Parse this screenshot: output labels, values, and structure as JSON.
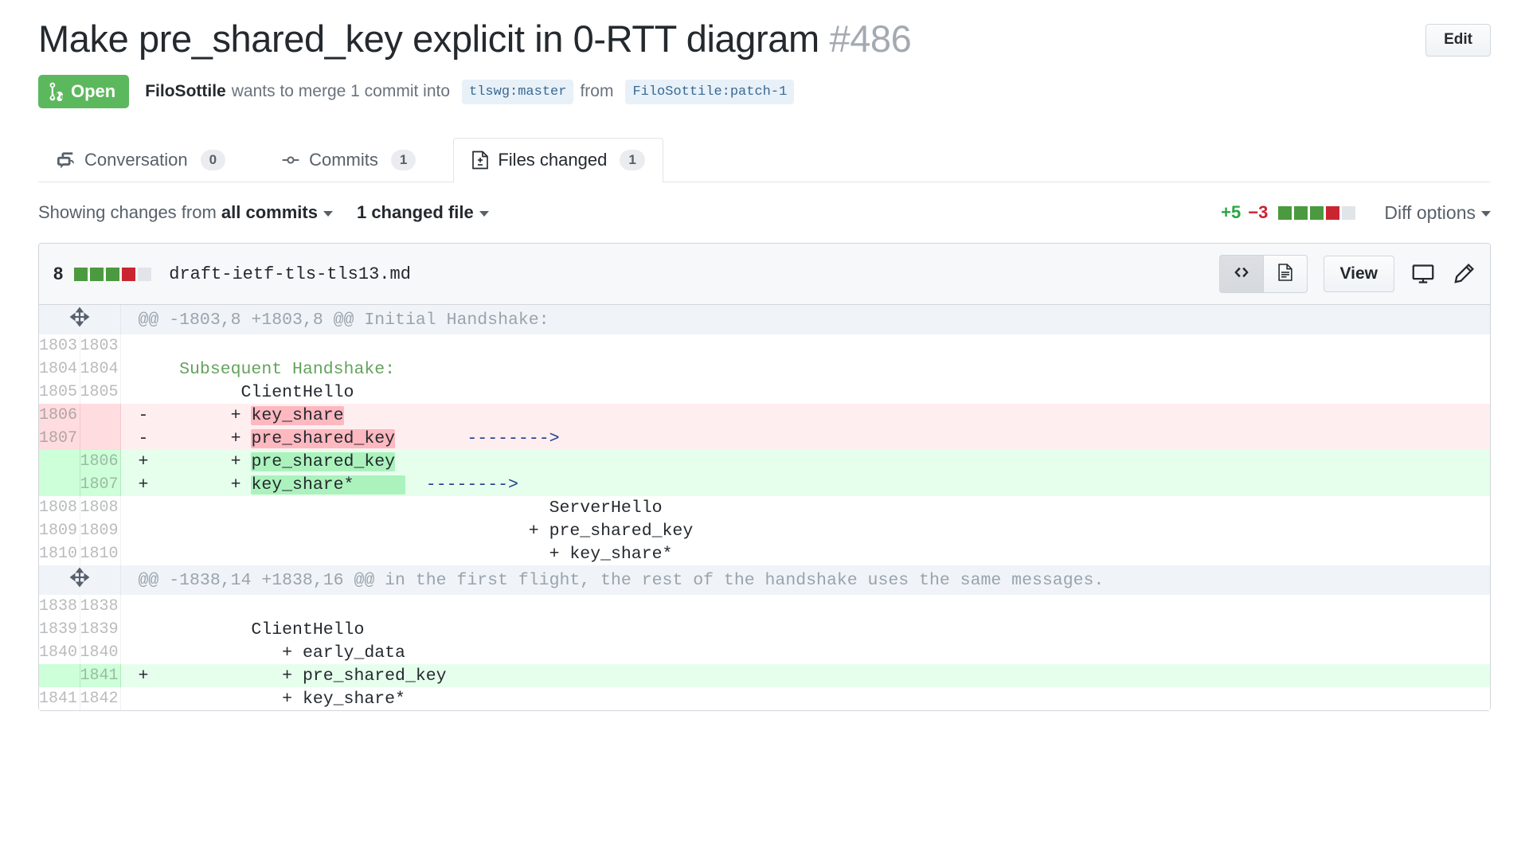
{
  "header": {
    "title": "Make pre_shared_key explicit in 0-RTT diagram",
    "number": "#486",
    "edit_label": "Edit",
    "state": "Open",
    "author": "FiloSottile",
    "merge_text_1": "wants to merge 1 commit into",
    "base_branch": "tlswg:master",
    "from_word": "from",
    "head_branch": "FiloSottile:patch-1"
  },
  "tabs": [
    {
      "label": "Conversation",
      "count": "0",
      "icon": "comment-discussion-icon",
      "active": false
    },
    {
      "label": "Commits",
      "count": "1",
      "icon": "git-commit-icon",
      "active": false
    },
    {
      "label": "Files changed",
      "count": "1",
      "icon": "diff-file-icon",
      "active": true
    }
  ],
  "toolbar": {
    "showing_prefix": "Showing changes from",
    "commits_filter": "all commits",
    "files_filter": "1 changed file",
    "additions": "+5",
    "deletions": "−3",
    "blocks": [
      "a",
      "a",
      "a",
      "d",
      "n"
    ],
    "diff_options": "Diff options"
  },
  "file": {
    "changes_count": "8",
    "blocks": [
      "a",
      "a",
      "a",
      "d",
      "n"
    ],
    "name": "draft-ietf-tls-tls13.md",
    "view_label": "View",
    "code_toggle_icon": "code-icon",
    "rendered_toggle_icon": "document-icon",
    "display_icon": "desktop-icon",
    "edit_icon": "pencil-icon"
  },
  "colors": {
    "open_green": "#5cb85c",
    "add_green": "#28a745",
    "del_red": "#cb2431",
    "word_add": "#acf2bd",
    "word_del": "#fdb8c0",
    "row_add": "#e6ffed",
    "row_del": "#ffeef0",
    "arrow_blue": "#1f3f8f"
  },
  "diff": {
    "hunks": [
      {
        "header": "@@ -1803,8 +1803,8 @@ Initial Handshake:",
        "rows": [
          {
            "type": "ctx",
            "old": "1803",
            "new": "1803",
            "marker": "",
            "segments": []
          },
          {
            "type": "ctx",
            "old": "1804",
            "new": "1804",
            "marker": "",
            "segments": [
              {
                "text": "   Subsequent Handshake:",
                "style": "md-h"
              }
            ]
          },
          {
            "type": "ctx",
            "old": "1805",
            "new": "1805",
            "marker": "",
            "segments": [
              {
                "text": "         ClientHello",
                "style": ""
              }
            ]
          },
          {
            "type": "del",
            "old": "1806",
            "new": "",
            "marker": "-",
            "segments": [
              {
                "text": "        + ",
                "style": ""
              },
              {
                "text": "key_share",
                "style": "wd-del"
              }
            ]
          },
          {
            "type": "del",
            "old": "1807",
            "new": "",
            "marker": "-",
            "segments": [
              {
                "text": "        + ",
                "style": ""
              },
              {
                "text": "pre_shared_key",
                "style": "wd-del"
              },
              {
                "text": "       ",
                "style": ""
              },
              {
                "text": "-------->",
                "style": "arrow"
              }
            ]
          },
          {
            "type": "add",
            "old": "",
            "new": "1806",
            "marker": "+",
            "segments": [
              {
                "text": "        + ",
                "style": ""
              },
              {
                "text": "pre_shared_key",
                "style": "wd-add"
              }
            ]
          },
          {
            "type": "add",
            "old": "",
            "new": "1807",
            "marker": "+",
            "segments": [
              {
                "text": "        + ",
                "style": ""
              },
              {
                "text": "key_share*     ",
                "style": "wd-add"
              },
              {
                "text": "  ",
                "style": ""
              },
              {
                "text": "-------->",
                "style": "arrow"
              }
            ]
          },
          {
            "type": "ctx",
            "old": "1808",
            "new": "1808",
            "marker": "",
            "segments": [
              {
                "text": "                                       ServerHello",
                "style": ""
              }
            ]
          },
          {
            "type": "ctx",
            "old": "1809",
            "new": "1809",
            "marker": "",
            "segments": [
              {
                "text": "                                     + pre_shared_key",
                "style": ""
              }
            ]
          },
          {
            "type": "ctx",
            "old": "1810",
            "new": "1810",
            "marker": "",
            "segments": [
              {
                "text": "                                       + key_share*",
                "style": ""
              }
            ]
          }
        ]
      },
      {
        "header": "@@ -1838,14 +1838,16 @@ in the first flight, the rest of the handshake uses the same messages.",
        "rows": [
          {
            "type": "ctx",
            "old": "1838",
            "new": "1838",
            "marker": "",
            "segments": []
          },
          {
            "type": "ctx",
            "old": "1839",
            "new": "1839",
            "marker": "",
            "segments": [
              {
                "text": "          ClientHello",
                "style": ""
              }
            ]
          },
          {
            "type": "ctx",
            "old": "1840",
            "new": "1840",
            "marker": "",
            "segments": [
              {
                "text": "             + early_data",
                "style": ""
              }
            ]
          },
          {
            "type": "add",
            "old": "",
            "new": "1841",
            "marker": "+",
            "segments": [
              {
                "text": "             + pre_shared_key",
                "style": ""
              }
            ]
          },
          {
            "type": "ctx",
            "old": "1841",
            "new": "1842",
            "marker": "",
            "segments": [
              {
                "text": "             + key_share*",
                "style": ""
              }
            ]
          }
        ]
      }
    ]
  }
}
